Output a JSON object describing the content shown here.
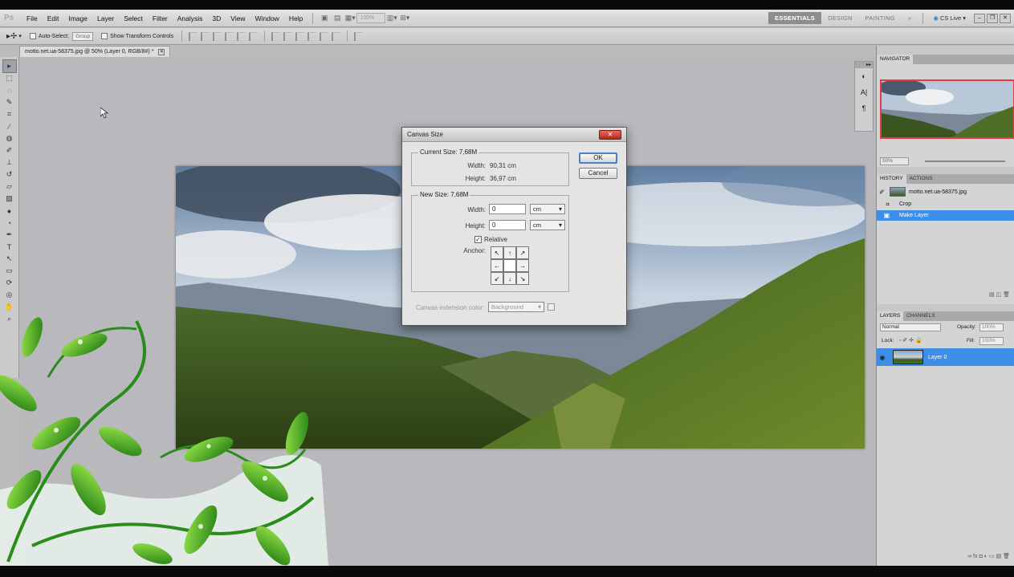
{
  "app": {
    "logo": "Ps"
  },
  "menu": [
    "File",
    "Edit",
    "Image",
    "Layer",
    "Select",
    "Filter",
    "Analysis",
    "3D",
    "View",
    "Window",
    "Help"
  ],
  "menubar": {
    "zoom": "100%"
  },
  "workspaces": [
    "ESSENTIALS",
    "DESIGN",
    "PAINTING"
  ],
  "workspace_more": "»",
  "cslive": "CS Live",
  "options": {
    "auto_select_label": "Auto-Select:",
    "auto_select_value": "Group",
    "show_transform_label": "Show Transform Controls"
  },
  "document": {
    "tab_title": "motto.net.ua-58375.jpg @ 50% (Layer 0, RGB/8#) *"
  },
  "dialog": {
    "title": "Canvas Size",
    "current_size_label": "Current Size: 7,68M",
    "current_width_label": "Width:",
    "current_width_value": "90,31 cm",
    "current_height_label": "Height:",
    "current_height_value": "36,97 cm",
    "new_size_label": "New Size: 7,68M",
    "width_label": "Width:",
    "width_value": "0",
    "width_unit": "cm",
    "height_label": "Height:",
    "height_value": "0",
    "height_unit": "cm",
    "relative_label": "Relative",
    "anchor_label": "Anchor:",
    "extension_label": "Canvas extension color:",
    "extension_value": "Background",
    "ok_label": "OK",
    "cancel_label": "Cancel"
  },
  "navigator": {
    "tab": "NAVIGATOR",
    "zoom": "50%"
  },
  "history": {
    "tabs": [
      "HISTORY",
      "ACTIONS"
    ],
    "snapshot": "motto.net.ua-58375.jpg",
    "items": [
      "Crop",
      "Make Layer"
    ]
  },
  "layers": {
    "tabs": [
      "LAYERS",
      "CHANNELS"
    ],
    "blend_mode": "Normal",
    "opacity_label": "Opacity:",
    "opacity_value": "100%",
    "lock_label": "Lock:",
    "fill_label": "Fill:",
    "fill_value": "100%",
    "layer_name": "Layer 0"
  },
  "colors": {
    "accent": "#3d8ee6",
    "dialog_close": "#c33b2b",
    "nav_border": "#e8394a"
  }
}
